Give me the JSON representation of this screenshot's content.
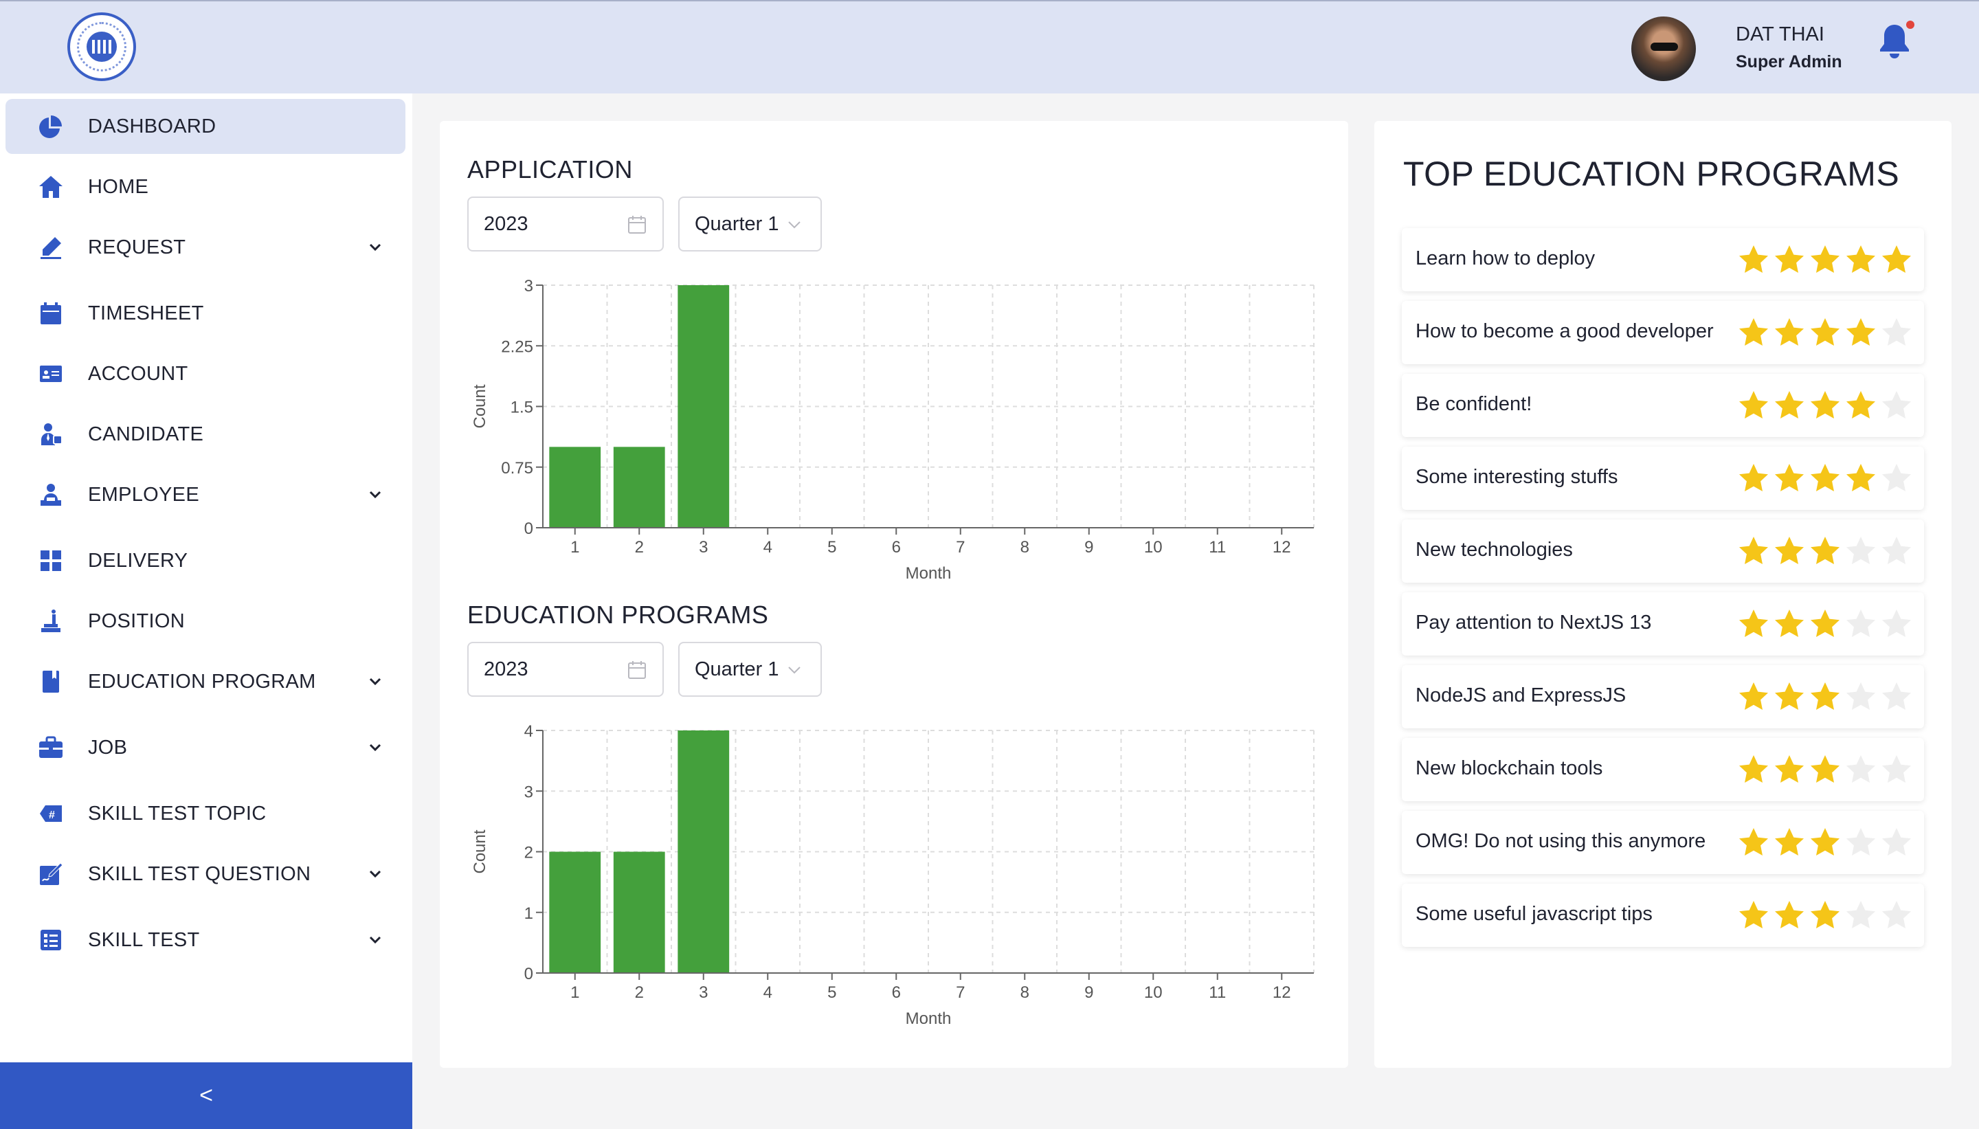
{
  "header": {
    "user_name": "DAT THAI",
    "user_role": "Super Admin",
    "accent": "#3158c4"
  },
  "sidebar": {
    "items": [
      {
        "label": "DASHBOARD",
        "icon": "pie-chart-icon",
        "active": true,
        "chevron": false
      },
      {
        "label": "HOME",
        "icon": "home-icon",
        "active": false,
        "chevron": false
      },
      {
        "label": "REQUEST",
        "icon": "pencil-icon",
        "active": false,
        "chevron": true
      },
      {
        "label": "TIMESHEET",
        "icon": "calendar-icon",
        "active": false,
        "chevron": false
      },
      {
        "label": "ACCOUNT",
        "icon": "id-card-icon",
        "active": false,
        "chevron": false
      },
      {
        "label": "CANDIDATE",
        "icon": "user-tie-icon",
        "active": false,
        "chevron": false
      },
      {
        "label": "EMPLOYEE",
        "icon": "employee-icon",
        "active": false,
        "chevron": true
      },
      {
        "label": "DELIVERY",
        "icon": "grid-icon",
        "active": false,
        "chevron": false
      },
      {
        "label": "POSITION",
        "icon": "position-icon",
        "active": false,
        "chevron": false
      },
      {
        "label": "EDUCATION PROGRAM",
        "icon": "book-icon",
        "active": false,
        "chevron": true
      },
      {
        "label": "JOB",
        "icon": "briefcase-icon",
        "active": false,
        "chevron": true
      },
      {
        "label": "SKILL TEST TOPIC",
        "icon": "hashtag-icon",
        "active": false,
        "chevron": false
      },
      {
        "label": "SKILL TEST QUESTION",
        "icon": "question-edit-icon",
        "active": false,
        "chevron": true
      },
      {
        "label": "SKILL TEST",
        "icon": "test-list-icon",
        "active": false,
        "chevron": true
      }
    ],
    "collapse_label": "<"
  },
  "application": {
    "title": "APPLICATION",
    "year": "2023",
    "quarter": "Quarter 1"
  },
  "education": {
    "title": "EDUCATION PROGRAMS",
    "year": "2023",
    "quarter": "Quarter 1"
  },
  "top_programs": {
    "title": "TOP EDUCATION PROGRAMS",
    "items": [
      {
        "name": "Learn how to deploy",
        "rating": 5
      },
      {
        "name": "How to become a good developer",
        "rating": 4
      },
      {
        "name": "Be confident!",
        "rating": 4
      },
      {
        "name": "Some interesting stuffs",
        "rating": 4
      },
      {
        "name": "New technologies",
        "rating": 3
      },
      {
        "name": "Pay attention to NextJS 13",
        "rating": 3
      },
      {
        "name": "NodeJS and ExpressJS",
        "rating": 3
      },
      {
        "name": "New blockchain tools",
        "rating": 3
      },
      {
        "name": "OMG! Do not using this anymore",
        "rating": 3
      },
      {
        "name": "Some useful javascript tips",
        "rating": 3
      }
    ],
    "star_color": "#f5c518",
    "star_empty_color": "#eeeeee"
  },
  "chart_data": [
    {
      "type": "bar",
      "categories": [
        "1",
        "2",
        "3",
        "4",
        "5",
        "6",
        "7",
        "8",
        "9",
        "10",
        "11",
        "12"
      ],
      "values": [
        1,
        1,
        3,
        0,
        0,
        0,
        0,
        0,
        0,
        0,
        0,
        0
      ],
      "xlabel": "Month",
      "ylabel": "Count",
      "ylim": [
        0,
        3
      ],
      "yticks": [
        "0",
        "0.75",
        "1.5",
        "2.25",
        "3"
      ],
      "color": "#44a03c",
      "grid": true
    },
    {
      "type": "bar",
      "categories": [
        "1",
        "2",
        "3",
        "4",
        "5",
        "6",
        "7",
        "8",
        "9",
        "10",
        "11",
        "12"
      ],
      "values": [
        2,
        2,
        4,
        0,
        0,
        0,
        0,
        0,
        0,
        0,
        0,
        0
      ],
      "xlabel": "Month",
      "ylabel": "Count",
      "ylim": [
        0,
        4
      ],
      "yticks": [
        "0",
        "1",
        "2",
        "3",
        "4"
      ],
      "color": "#44a03c",
      "grid": true
    }
  ]
}
